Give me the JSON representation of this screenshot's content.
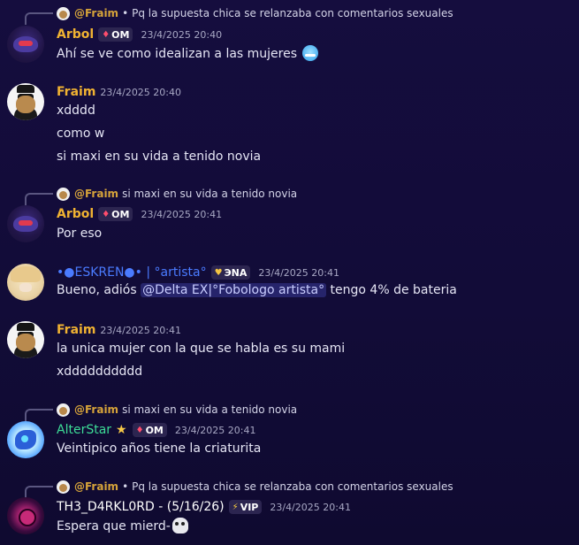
{
  "messages": [
    {
      "reply": {
        "mention": "@Fraim",
        "text": "Pq la supuesta chica se relanzaba con comentarios sexuales"
      },
      "author": "Arbol",
      "tag": {
        "label": "OM",
        "icon": "gem-icon"
      },
      "time": "23/4/2025 20:40",
      "lines": [
        "Ahí se ve como idealizan a las mujeres"
      ]
    },
    {
      "author": "Fraim",
      "time": "23/4/2025 20:40",
      "lines": [
        "xdddd",
        "como w",
        "si maxi en su vida a tenido novia"
      ]
    },
    {
      "reply": {
        "mention": "@Fraim",
        "text": "si maxi en su vida a tenido novia"
      },
      "author": "Arbol",
      "tag": {
        "label": "OM",
        "icon": "gem-icon"
      },
      "time": "23/4/2025 20:41",
      "lines": [
        "Por eso"
      ]
    },
    {
      "author": "•●ESKREN●• | °artista°",
      "tag": {
        "label": "ЭNA",
        "icon": "heart-icon"
      },
      "time": "23/4/2025 20:41",
      "line_before": "Bueno, adiós",
      "mention": "@Delta EX|°Fobologo artista°",
      "line_after": "tengo 4% de bateria"
    },
    {
      "author": "Fraim",
      "time": "23/4/2025 20:41",
      "lines": [
        "la unica mujer con la que se habla es su mami",
        "xdddddddddd"
      ]
    },
    {
      "reply": {
        "mention": "@Fraim",
        "text": "si maxi en su vida a tenido novia"
      },
      "author": "AlterStar",
      "star": "★",
      "tag": {
        "label": "OM",
        "icon": "gem-icon"
      },
      "time": "23/4/2025 20:41",
      "lines": [
        "Veintipico años tiene la criaturita"
      ]
    },
    {
      "reply": {
        "mention": "@Fraim",
        "text": "Pq la supuesta chica se relanzaba con comentarios sexuales"
      },
      "author": "TH3_D4RKL0RD - (5/16/26)",
      "tag": {
        "label": "VIP",
        "icon": "lightning-icon"
      },
      "time": "23/4/2025 20:41",
      "lines": [
        "Espera que mierd-"
      ]
    }
  ],
  "icons": {
    "gem": "♦",
    "heart": "♥",
    "bolt": "⚡",
    "dot": "•"
  }
}
